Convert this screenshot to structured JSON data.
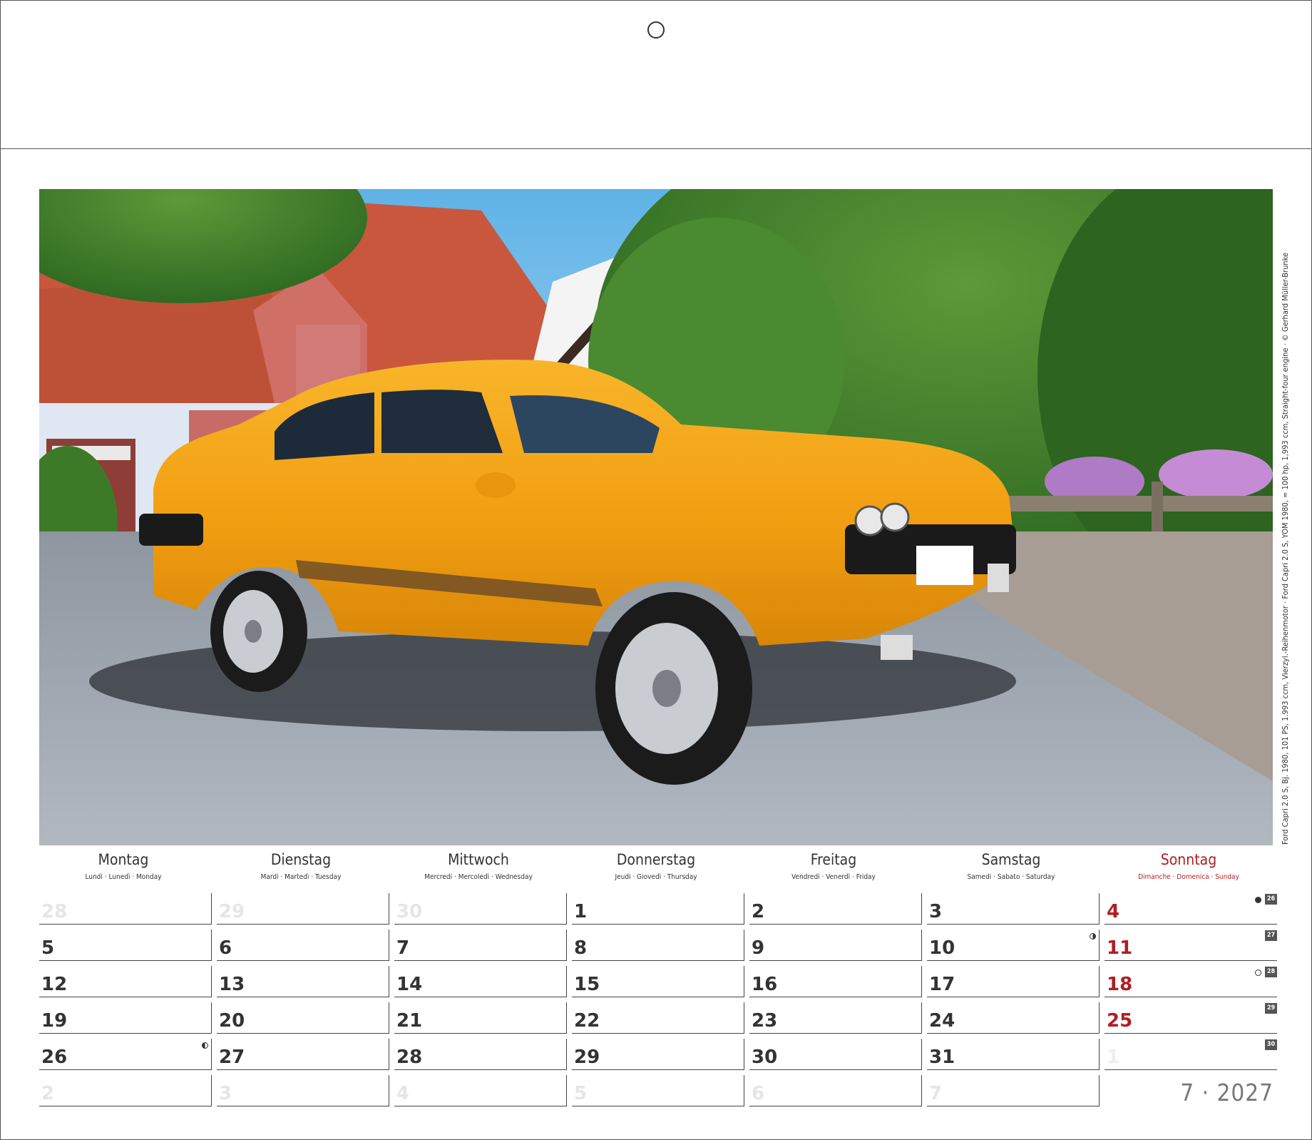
{
  "photo": {
    "subject": "orange Ford Capri coupe",
    "credit": "Ford Capri 2.0 S, Bj. 1980, 101 PS, 1.993 ccm, Vierzyl.-Reihenmotor · Ford Capri 2.0 S, YOM 1980, ≈ 100 hp, 1,993 ccm, Straight-four engine · © Gerhard Müller-Brunke"
  },
  "weekdays": [
    {
      "name": "Montag",
      "sub": "Lundi · Lunedì · Monday"
    },
    {
      "name": "Dienstag",
      "sub": "Mardi · Martedì · Tuesday"
    },
    {
      "name": "Mittwoch",
      "sub": "Mercredi · Mercoledì · Wednesday"
    },
    {
      "name": "Donnerstag",
      "sub": "Jeudi · Giovedì · Thursday"
    },
    {
      "name": "Freitag",
      "sub": "Vendredi · Venerdì · Friday"
    },
    {
      "name": "Samstag",
      "sub": "Samedi · Sabato · Saturday"
    },
    {
      "name": "Sonntag",
      "sub": "Dimanche · Domenica · Sunday"
    }
  ],
  "weeks": [
    {
      "kw": "26",
      "days": [
        "28",
        "29",
        "30",
        "1",
        "2",
        "3",
        "4"
      ]
    },
    {
      "kw": "27",
      "days": [
        "5",
        "6",
        "7",
        "8",
        "9",
        "10",
        "11"
      ]
    },
    {
      "kw": "28",
      "days": [
        "12",
        "13",
        "14",
        "15",
        "16",
        "17",
        "18"
      ]
    },
    {
      "kw": "29",
      "days": [
        "19",
        "20",
        "21",
        "22",
        "23",
        "24",
        "25"
      ]
    },
    {
      "kw": "30",
      "days": [
        "26",
        "27",
        "28",
        "29",
        "30",
        "31",
        "1"
      ]
    },
    {
      "kw": "",
      "days": [
        "2",
        "3",
        "4",
        "5",
        "6",
        "7",
        ""
      ]
    }
  ],
  "inactive": [
    [
      0,
      0
    ],
    [
      0,
      1
    ],
    [
      0,
      2
    ],
    [
      4,
      6
    ],
    [
      5,
      0
    ],
    [
      5,
      1
    ],
    [
      5,
      2
    ],
    [
      5,
      3
    ],
    [
      5,
      4
    ],
    [
      5,
      5
    ]
  ],
  "moons": [
    {
      "week": 0,
      "col": 6,
      "phase": "full"
    },
    {
      "week": 1,
      "col": 5,
      "phase": "half-r"
    },
    {
      "week": 2,
      "col": 6,
      "phase": "new"
    },
    {
      "week": 4,
      "col": 0,
      "phase": "half-l"
    }
  ],
  "month_year": "7 · 2027",
  "colors": {
    "sunday": "#b01e23",
    "car": "#f2a213",
    "roof": "#c9573d"
  }
}
